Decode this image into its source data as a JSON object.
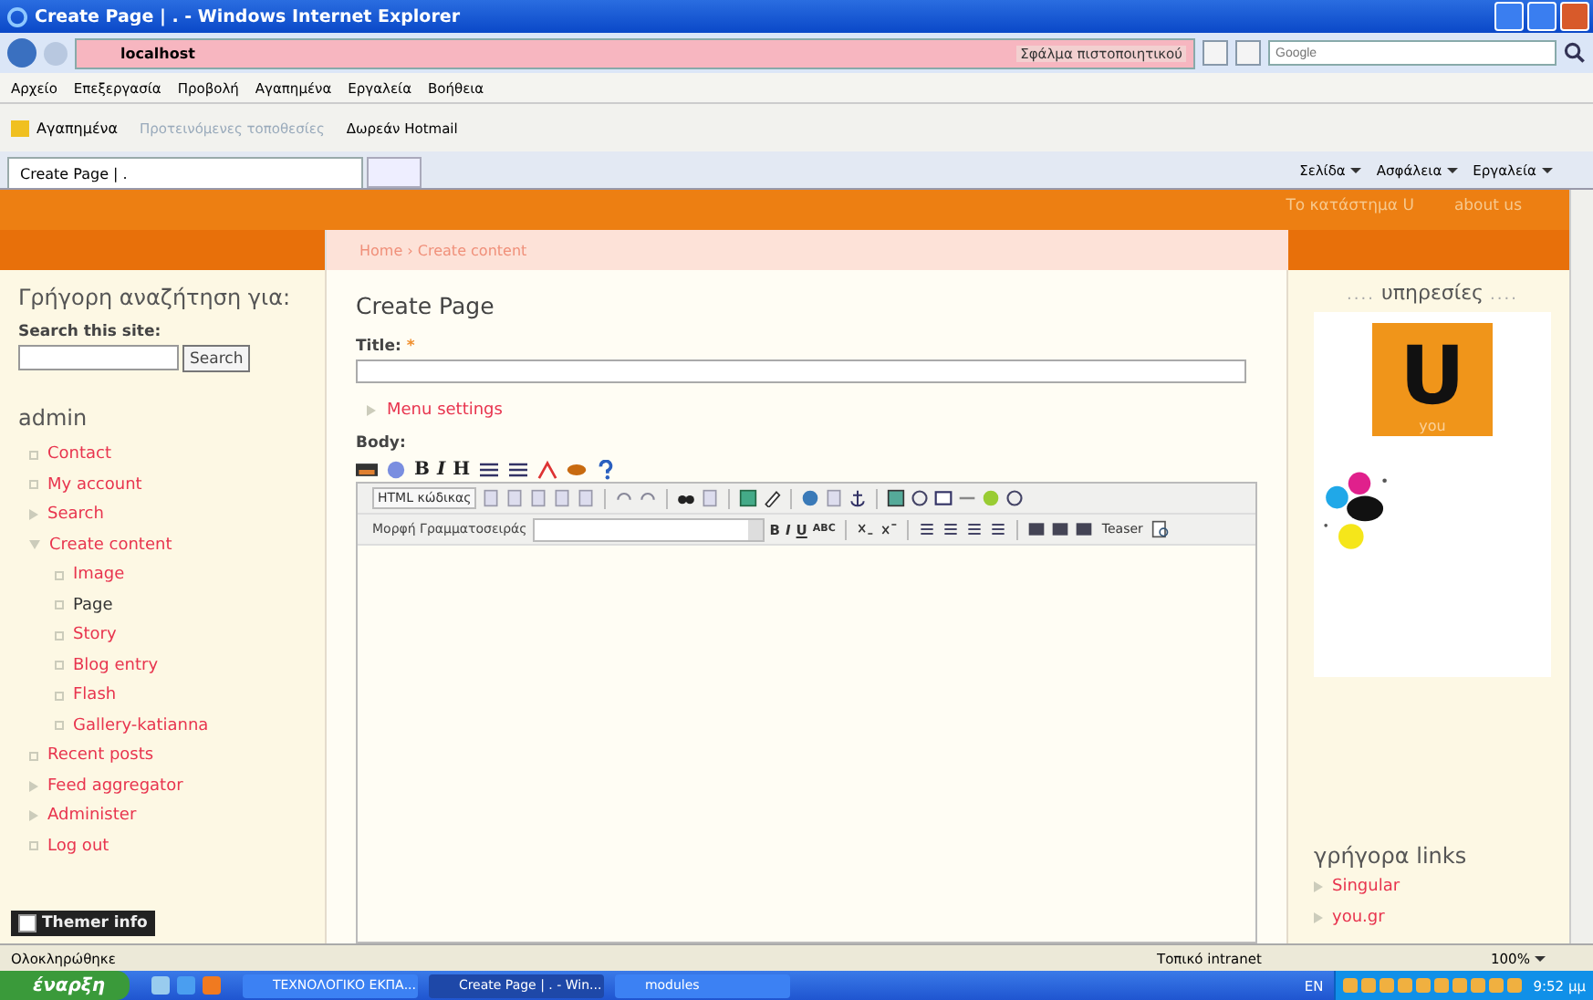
{
  "window": {
    "title": "Create Page | . - Windows Internet Explorer"
  },
  "address_bar": {
    "url": "localhost",
    "certificate_error": "Σφάλμα πιστοποιητικού",
    "search_placeholder": "Google"
  },
  "menu_bar": [
    "Αρχείο",
    "Επεξεργασία",
    "Προβολή",
    "Αγαπημένα",
    "Εργαλεία",
    "Βοήθεια"
  ],
  "favorites_bar": {
    "label": "Αγαπημένα",
    "items": [
      "Προτεινόμενες τοποθεσίες",
      "Δωρεάν Hotmail"
    ]
  },
  "tabs": [
    {
      "label": "Create Page | .",
      "selected": true
    }
  ],
  "command_bar": [
    "Σελίδα",
    "Ασφάλεια",
    "Εργαλεία"
  ],
  "site_header": {
    "links": [
      "Το κατάστημα U",
      "about us"
    ]
  },
  "breadcrumb": "Home › Create content",
  "search_block": {
    "title": "Γρήγορη αναζήτηση για:",
    "label": "Search this site:",
    "button": "Search"
  },
  "admin_menu": {
    "title": "admin",
    "items": [
      {
        "label": "Contact",
        "kind": "leaf",
        "selected": false
      },
      {
        "label": "My account",
        "kind": "leaf",
        "selected": false
      },
      {
        "label": "Search",
        "kind": "collapsed",
        "selected": false
      },
      {
        "label": "Create content",
        "kind": "expanded",
        "selected": false,
        "children": [
          {
            "label": "Image",
            "kind": "leaf",
            "selected": false
          },
          {
            "label": "Page",
            "kind": "leaf",
            "selected": true
          },
          {
            "label": "Story",
            "kind": "leaf",
            "selected": false
          },
          {
            "label": "Blog entry",
            "kind": "leaf",
            "selected": false
          },
          {
            "label": "Flash",
            "kind": "leaf",
            "selected": false
          },
          {
            "label": "Gallery-katianna",
            "kind": "leaf",
            "selected": false
          }
        ]
      },
      {
        "label": "Recent posts",
        "kind": "leaf",
        "selected": false
      },
      {
        "label": "Feed aggregator",
        "kind": "collapsed",
        "selected": false
      },
      {
        "label": "Administer",
        "kind": "collapsed",
        "selected": false
      },
      {
        "label": "Log out",
        "kind": "leaf",
        "selected": false
      }
    ]
  },
  "themer_info": {
    "label": "Themer info",
    "checked": false
  },
  "form": {
    "heading": "Create Page",
    "title_label": "Title:",
    "required_mark": "*",
    "menu_settings": "Menu settings",
    "body_label": "Body:",
    "quick_buttons": [
      "B",
      "I",
      "H"
    ],
    "html_button": "HTML κώδικας",
    "font_select": "Μορφή Γραμματοσειράς",
    "format_buttons": [
      "B",
      "I",
      "U",
      "ABC"
    ],
    "teaser_button": "Teaser"
  },
  "services_block": {
    "title": "υπηρεσίες",
    "dots": "....",
    "logo_letter": "U",
    "logo_caption": "you"
  },
  "quick_links": {
    "title": "γρήγορα links",
    "items": [
      "Singular",
      "you.gr"
    ]
  },
  "status_bar": {
    "text": "Ολοκληρώθηκε",
    "zone": "Τοπικό intranet",
    "zoom": "100%"
  },
  "taskbar": {
    "start": "έναρξη",
    "tasks": [
      {
        "label": "ΤΕΧΝΟΛΟΓΙΚΟ ΕΚΠΑ...",
        "selected": false
      },
      {
        "label": "Create Page | . - Win...",
        "selected": true
      },
      {
        "label": "modules",
        "selected": false
      }
    ],
    "language": "EN",
    "clock": "9:52 μμ"
  }
}
